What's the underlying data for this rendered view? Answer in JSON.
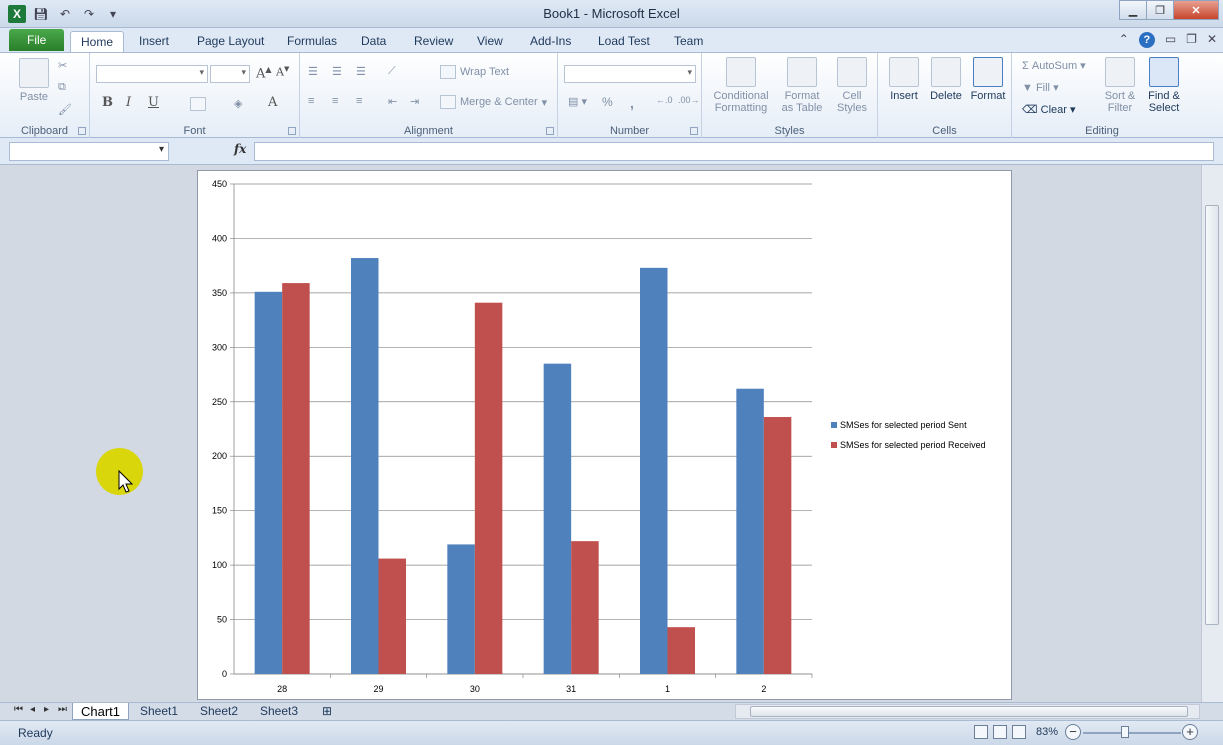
{
  "window": {
    "title": "Book1 - Microsoft Excel",
    "controls": [
      "minimize",
      "restore",
      "close"
    ]
  },
  "ribbon_tabs": [
    "File",
    "Home",
    "Insert",
    "Page Layout",
    "Formulas",
    "Data",
    "Review",
    "View",
    "Add-Ins",
    "Load Test",
    "Team"
  ],
  "active_tab": "Home",
  "ribbon": {
    "clipboard": {
      "label": "Clipboard",
      "paste": "Paste"
    },
    "font": {
      "label": "Font",
      "bold": "B",
      "italic": "I",
      "underline": "U"
    },
    "alignment": {
      "label": "Alignment",
      "wrap_text": "Wrap Text",
      "merge_center": "Merge & Center"
    },
    "number": {
      "label": "Number",
      "percent": "%",
      "comma": ","
    },
    "styles": {
      "label": "Styles",
      "conditional_1": "Conditional",
      "conditional_2": "Formatting",
      "format_table_1": "Format",
      "format_table_2": "as Table",
      "cell_styles_1": "Cell",
      "cell_styles_2": "Styles"
    },
    "cells": {
      "label": "Cells",
      "insert": "Insert",
      "delete": "Delete",
      "format": "Format"
    },
    "editing": {
      "label": "Editing",
      "autosum": "AutoSum",
      "fill": "Fill",
      "clear": "Clear",
      "sort_1": "Sort &",
      "sort_2": "Filter",
      "find_1": "Find &",
      "find_2": "Select"
    }
  },
  "formula_bar": {
    "fx": "fx",
    "name_box": "",
    "formula": ""
  },
  "chart_data": {
    "type": "bar",
    "categories": [
      "28",
      "29",
      "30",
      "31",
      "1",
      "2"
    ],
    "series": [
      {
        "name": "SMSes for selected period Sent",
        "color": "#4f81bd",
        "values": [
          351,
          382,
          119,
          285,
          373,
          262
        ]
      },
      {
        "name": "SMSes for selected period Received",
        "color": "#c0504d",
        "values": [
          359,
          106,
          341,
          122,
          43,
          236
        ]
      }
    ],
    "yticks": [
      "0",
      "50",
      "100",
      "150",
      "200",
      "250",
      "300",
      "350",
      "400",
      "450"
    ],
    "ylim": [
      0,
      450
    ],
    "grid": true,
    "legend": "right"
  },
  "sheet_tabs": [
    "Chart1",
    "Sheet1",
    "Sheet2",
    "Sheet3"
  ],
  "active_sheet": "Chart1",
  "status": {
    "text": "Ready",
    "zoom": "83%"
  }
}
